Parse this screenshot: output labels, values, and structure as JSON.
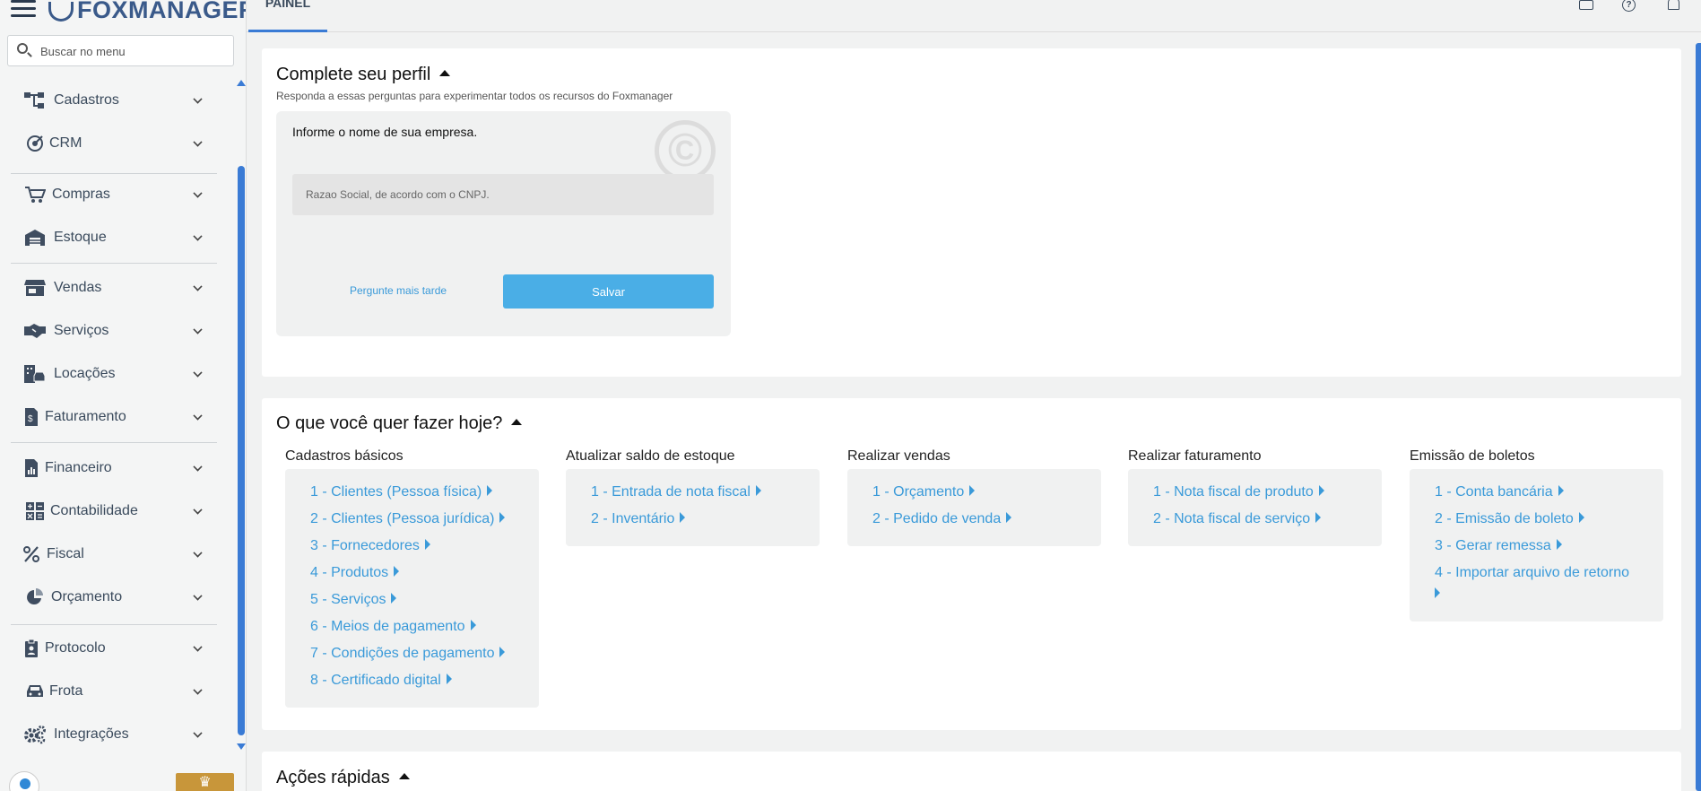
{
  "app": {
    "logo_text": "FOXMANAGER"
  },
  "search": {
    "placeholder": "Buscar no menu"
  },
  "sidebar": {
    "items": [
      {
        "label": "Cadastros",
        "icon": "sitemap-icon"
      },
      {
        "label": "CRM",
        "icon": "target-icon"
      },
      {
        "label": "Compras",
        "icon": "cart-icon"
      },
      {
        "label": "Estoque",
        "icon": "warehouse-icon"
      },
      {
        "label": "Vendas",
        "icon": "store-icon"
      },
      {
        "label": "Serviços",
        "icon": "handshake-icon"
      },
      {
        "label": "Locações",
        "icon": "building-car-icon"
      },
      {
        "label": "Faturamento",
        "icon": "invoice-icon"
      },
      {
        "label": "Financeiro",
        "icon": "finance-chart-icon"
      },
      {
        "label": "Contabilidade",
        "icon": "calculator-icon"
      },
      {
        "label": "Fiscal",
        "icon": "percent-icon"
      },
      {
        "label": "Orçamento",
        "icon": "pie-chart-icon"
      },
      {
        "label": "Protocolo",
        "icon": "clipboard-icon"
      },
      {
        "label": "Frota",
        "icon": "car-icon"
      },
      {
        "label": "Integrações",
        "icon": "gears-icon"
      }
    ]
  },
  "topbar": {
    "tab": "PAINEL",
    "icons": [
      "mail-icon",
      "help-icon",
      "bell-icon"
    ]
  },
  "profile": {
    "title": "Complete seu perfil",
    "subtitle": "Responda a essas perguntas para experimentar todos os recursos do Foxmanager",
    "question": "Informe o nome de sua empresa.",
    "input_placeholder": "Razao Social, de acordo com o CNPJ.",
    "later_label": "Pergunte mais tarde",
    "save_label": "Salvar"
  },
  "today": {
    "title": "O que você quer fazer hoje?",
    "columns": [
      {
        "title": "Cadastros básicos",
        "links": [
          "1 - Clientes (Pessoa física)",
          "2 - Clientes (Pessoa jurídica)",
          "3 - Fornecedores",
          "4 - Produtos",
          "5 - Serviços",
          "6 - Meios de pagamento",
          "7 - Condições de pagamento",
          "8 - Certificado digital"
        ]
      },
      {
        "title": "Atualizar saldo de estoque",
        "links": [
          "1 - Entrada de nota fiscal",
          "2 - Inventário"
        ]
      },
      {
        "title": "Realizar vendas",
        "links": [
          "1 - Orçamento",
          "2 - Pedido de venda"
        ]
      },
      {
        "title": "Realizar faturamento",
        "links": [
          "1 - Nota fiscal de produto",
          "2 - Nota fiscal de serviço"
        ]
      },
      {
        "title": "Emissão de boletos",
        "links": [
          "1 - Conta bancária",
          "2 - Emissão de boleto",
          "3 - Gerar remessa",
          "4 - Importar arquivo de retorno"
        ]
      }
    ]
  },
  "quick_actions": {
    "title": "Ações rápidas"
  },
  "colors": {
    "accent": "#3a7bd5",
    "link": "#3a9ad9",
    "button": "#4aaee6",
    "premium": "#c8963a"
  }
}
